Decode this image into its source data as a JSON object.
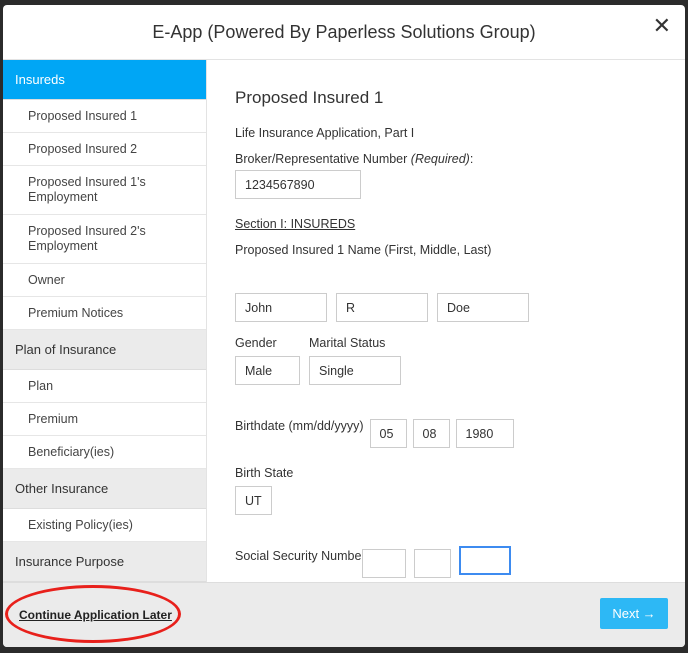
{
  "title": "E-App (Powered By Paperless Solutions Group)",
  "close_icon": "close-icon",
  "sidebar": [
    {
      "section": "Insureds",
      "active": true,
      "items": [
        "Proposed Insured 1",
        "Proposed Insured 2",
        "Proposed Insured 1's Employment",
        "Proposed Insured 2's Employment",
        "Owner",
        "Premium Notices"
      ]
    },
    {
      "section": "Plan of Insurance",
      "items": [
        "Plan",
        "Premium",
        "Beneficiary(ies)"
      ]
    },
    {
      "section": "Other Insurance",
      "items": [
        "Existing Policy(ies)"
      ]
    },
    {
      "section": "Insurance Purpose",
      "items": []
    }
  ],
  "main": {
    "heading": "Proposed Insured 1",
    "subtitle": "Life Insurance Application, Part I",
    "broker_label": "Broker/Representative Number ",
    "broker_required": "(Required)",
    "broker_colon": ":",
    "broker_value": "1234567890",
    "section_link": "Section I: INSUREDS",
    "name_label": "Proposed Insured 1 Name (First, Middle, Last)",
    "first": "John",
    "middle": "R",
    "last": "Doe",
    "gender_label": "Gender",
    "gender": "Male",
    "marital_label": "Marital Status",
    "marital": "Single",
    "birthdate_label": "Birthdate (mm/dd/yyyy)",
    "mm": "05",
    "dd": "08",
    "yyyy": "1980",
    "birth_state_label": "Birth State",
    "birth_state": "UT",
    "ssn_label": "Social Security Number"
  },
  "footer": {
    "later": "Continue Application Later",
    "next": "Next →"
  },
  "colors": {
    "accent": "#00a6f5",
    "button": "#2db8f5",
    "annotation": "#e8201b"
  }
}
